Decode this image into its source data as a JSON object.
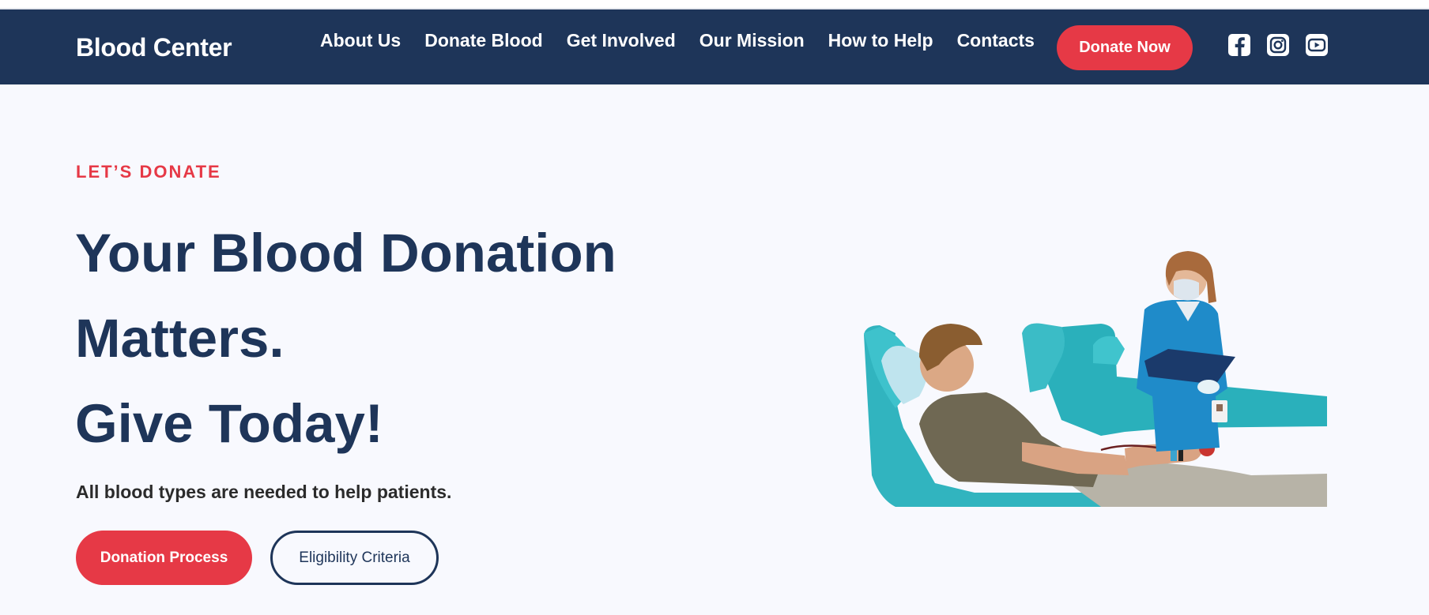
{
  "header": {
    "brand": "Blood Center",
    "nav": [
      "About Us",
      "Donate Blood",
      "Get Involved",
      "Our Mission",
      "How to Help",
      "Contacts"
    ],
    "cta_label": "Donate Now",
    "social_icons": [
      "facebook-icon",
      "instagram-icon",
      "youtube-icon"
    ]
  },
  "hero": {
    "eyebrow": "LET’S DONATE",
    "headline": [
      "Your Blood Donation",
      "Matters.",
      "Give Today!"
    ],
    "subtitle": "All blood types are needed to help patients.",
    "primary_button": "Donation Process",
    "secondary_button": "Eligibility Criteria"
  },
  "colors": {
    "navy": "#1e3559",
    "accent_red": "#e63946",
    "hero_background": "#f8f9fe"
  }
}
